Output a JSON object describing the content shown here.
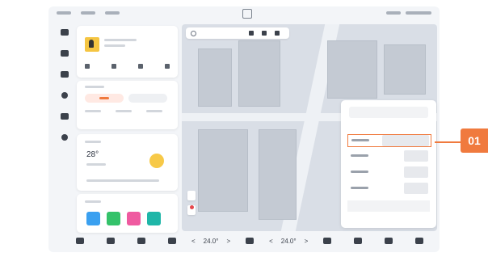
{
  "dock": {
    "temp_left": "24.0°",
    "temp_right": "24.0°",
    "arrow_left": "<",
    "arrow_right": ">"
  },
  "weather": {
    "temp": "28°"
  },
  "callout": {
    "label": "01"
  },
  "colors": {
    "accent": "#f07a3e",
    "app_blue": "#3aa0f0",
    "app_green": "#34c26a",
    "app_pink": "#ef5aa0",
    "app_teal": "#1fb6a8"
  },
  "icons": [
    "car-icon",
    "home-icon",
    "music-icon",
    "phone-icon",
    "apps-icon",
    "settings-icon",
    "search-icon",
    "sun-icon",
    "seat-icon",
    "fan-icon",
    "grid-icon",
    "volume-icon"
  ]
}
